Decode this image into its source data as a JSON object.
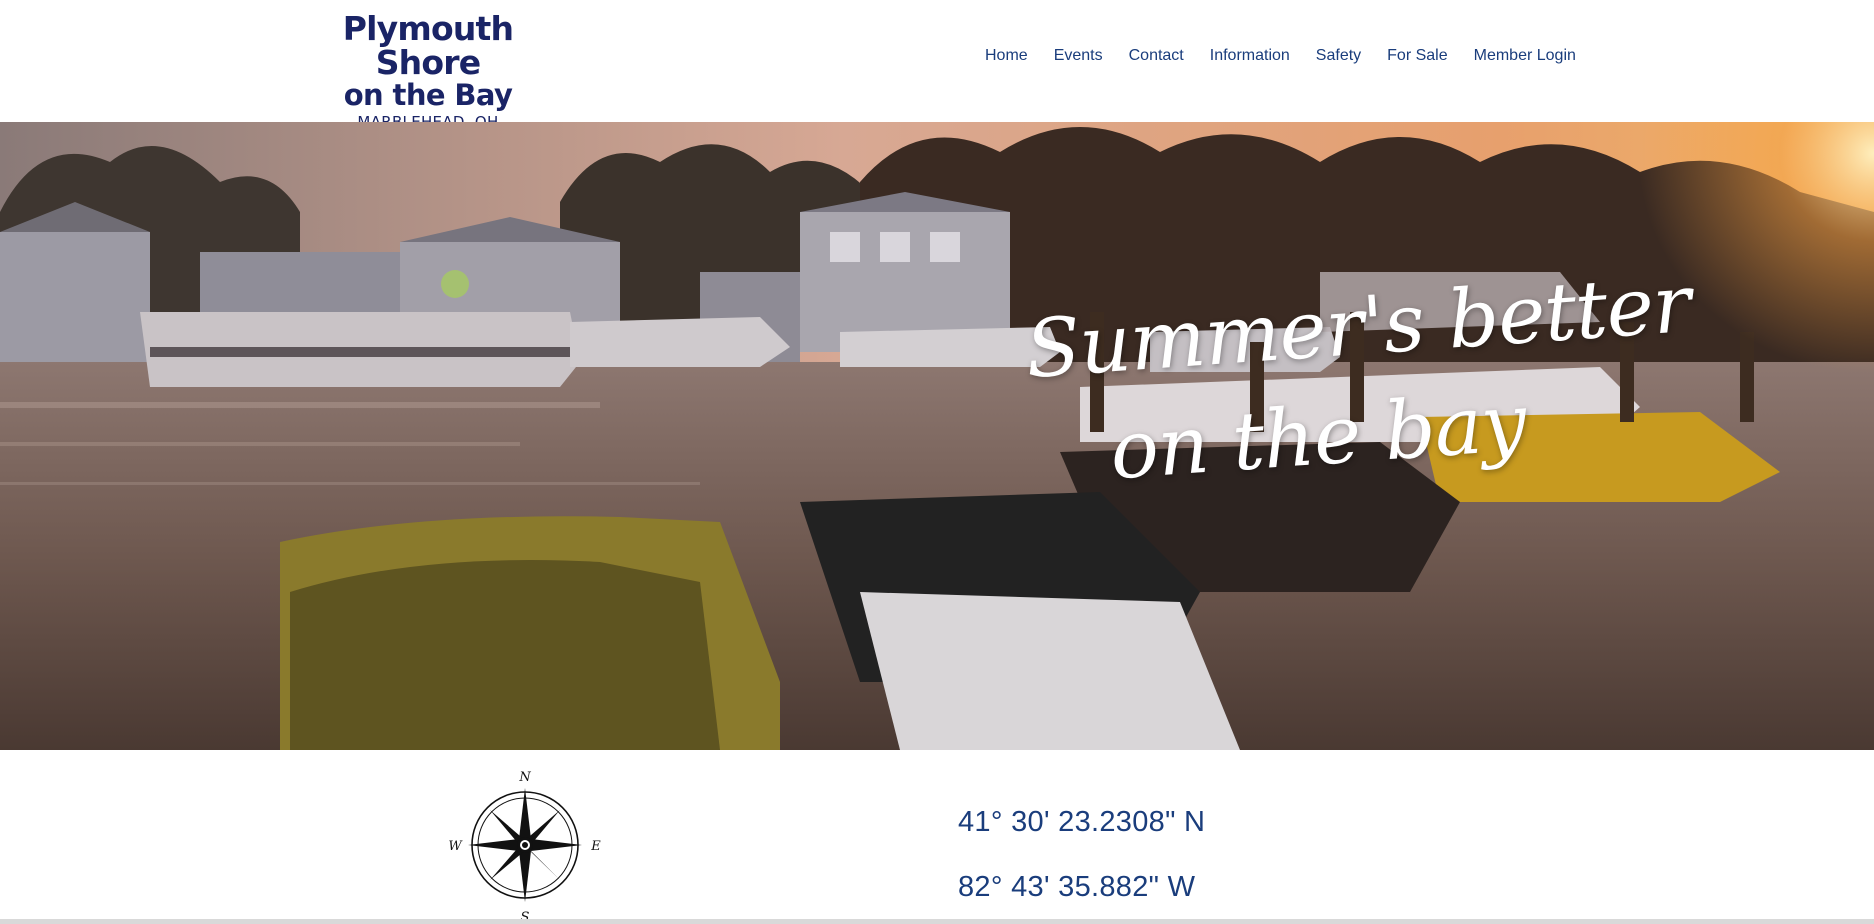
{
  "site": {
    "logo": {
      "line1": "Plymouth Shore",
      "line2": "on the Bay",
      "line3": "MARBLEHEAD, OH"
    }
  },
  "nav": {
    "items": [
      {
        "label": "Home"
      },
      {
        "label": "Events"
      },
      {
        "label": "Contact"
      },
      {
        "label": "Information"
      },
      {
        "label": "Safety"
      },
      {
        "label": "For Sale"
      },
      {
        "label": "Member Login"
      }
    ]
  },
  "hero": {
    "line1": "Summer's better",
    "line2": "on the bay"
  },
  "compass": {
    "n": "N",
    "s": "S",
    "e": "E",
    "w": "W"
  },
  "coordinates": {
    "latitude": "41° 30' 23.2308\" N",
    "longitude": "82° 43' 35.882\" W"
  },
  "colors": {
    "brand_navy": "#1a2466",
    "nav_blue": "#1a3d7c"
  }
}
